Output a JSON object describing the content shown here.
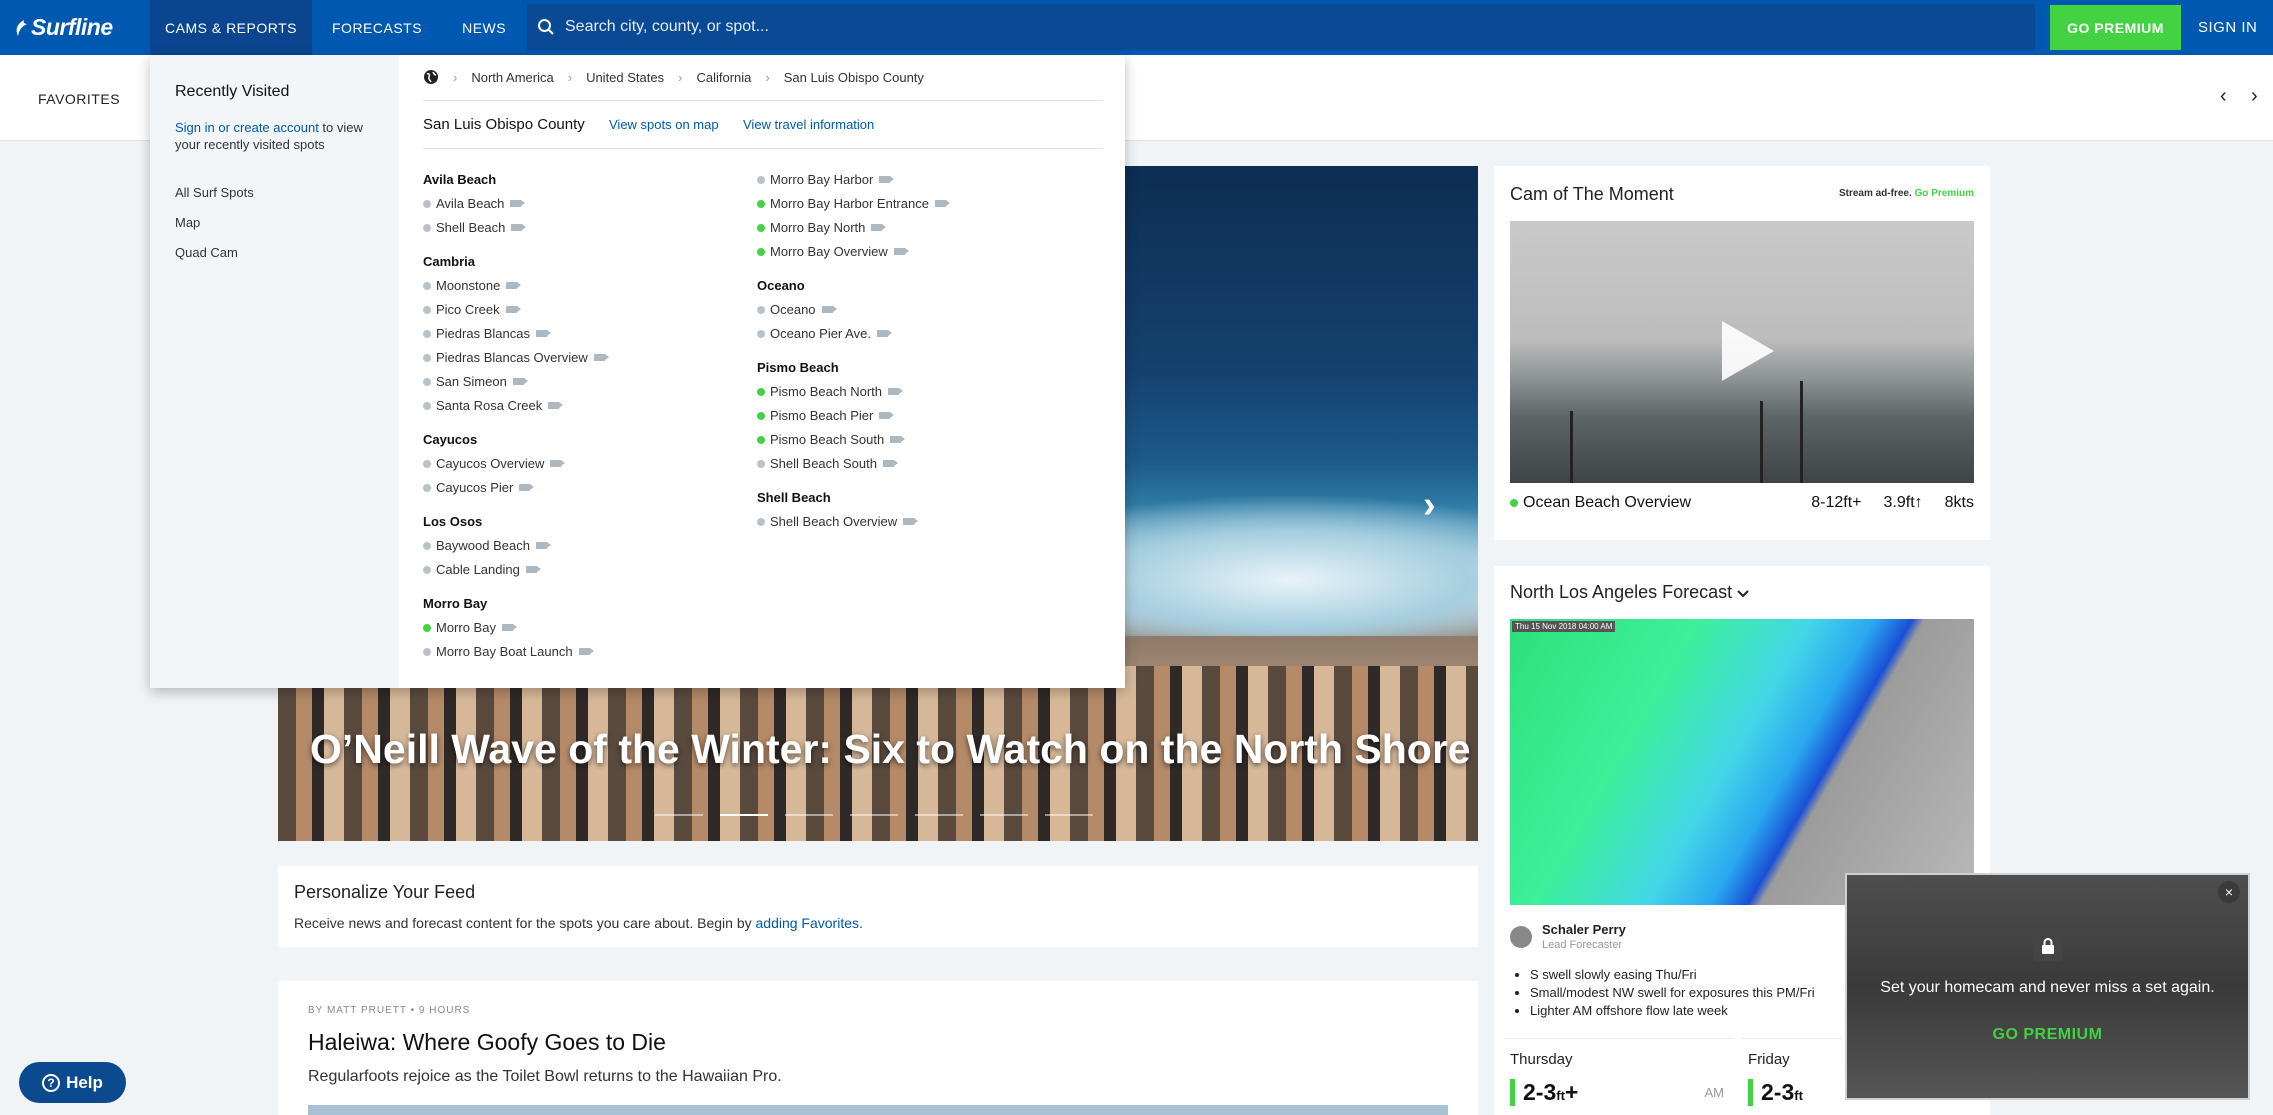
{
  "nav": {
    "logo": "Surfline",
    "tabs": [
      "CAMS & REPORTS",
      "FORECASTS",
      "NEWS"
    ],
    "search_placeholder": "Search city, county, or spot...",
    "premium": "GO PREMIUM",
    "signin": "SIGN IN"
  },
  "favbar": {
    "label": "FAVORITES",
    "prev": "‹",
    "next": "›"
  },
  "hero": {
    "title": "O’Neill Wave of the Winter: Six to Watch on the North Shore",
    "next": "›"
  },
  "feed": {
    "title": "Personalize Your Feed",
    "text": "Receive news and forecast content for the spots you care about. Begin by ",
    "link": "adding Favorites",
    "end": "."
  },
  "article": {
    "byline": "BY MATT PRUETT • 9 HOURS",
    "title": "Haleiwa: Where Goofy Goes to Die",
    "subtitle": "Regularfoots rejoice as the Toilet Bowl returns to the Hawaiian Pro."
  },
  "cotm": {
    "title": "Cam of The Moment",
    "stream_text": "Stream ad-free.",
    "stream_link": "Go Premium",
    "spot": "Ocean Beach Overview",
    "height": "8-12ft+",
    "swell": "3.9ft↑",
    "wind": "8kts"
  },
  "nla": {
    "title": "North Los Angeles Forecast",
    "map_stamp": "Thu 15 Nov 2018 04:00 AM",
    "forecaster": "Schaler Perry",
    "role": "Lead Forecaster",
    "bullets": [
      "S swell slowly easing Thu/Fri",
      "Small/modest NW swell for exposures this PM/Fri",
      "Lighter AM offshore flow late week"
    ],
    "days": [
      {
        "name": "Thursday",
        "value": "2-3",
        "unit": "ft",
        "plus": "+",
        "period": "AM"
      },
      {
        "name": "Friday",
        "value": "2-3",
        "unit": "ft",
        "plus": "",
        "period": ""
      }
    ]
  },
  "homecam": {
    "message": "Set your homecam and never miss a set again.",
    "cta": "GO PREMIUM",
    "close": "×"
  },
  "help": {
    "label": "Help",
    "icon": "?"
  },
  "dropdown": {
    "recent_title": "Recently Visited",
    "signin_link": "Sign in or create account",
    "signin_rest": " to view your recently visited spots",
    "links": [
      "All Surf Spots",
      "Map",
      "Quad Cam"
    ],
    "breadcrumb": [
      "North America",
      "United States",
      "California",
      "San Luis Obispo County"
    ],
    "county": "San Luis Obispo County",
    "view_map": "View spots on map",
    "view_travel": "View travel information",
    "left_col": [
      {
        "region": "Avila Beach",
        "spots": [
          [
            "Avila Beach",
            false
          ],
          [
            "Shell Beach",
            false
          ]
        ]
      },
      {
        "region": "Cambria",
        "spots": [
          [
            "Moonstone",
            false
          ],
          [
            "Pico Creek",
            false
          ],
          [
            "Piedras Blancas",
            false
          ],
          [
            "Piedras Blancas Overview",
            false
          ],
          [
            "San Simeon",
            false
          ],
          [
            "Santa Rosa Creek",
            false
          ]
        ]
      },
      {
        "region": "Cayucos",
        "spots": [
          [
            "Cayucos Overview",
            false
          ],
          [
            "Cayucos Pier",
            false
          ]
        ]
      },
      {
        "region": "Los Osos",
        "spots": [
          [
            "Baywood Beach",
            false
          ],
          [
            "Cable Landing",
            false
          ]
        ]
      },
      {
        "region": "Morro Bay",
        "spots": [
          [
            "Morro Bay",
            true
          ],
          [
            "Morro Bay Boat Launch",
            false
          ]
        ]
      }
    ],
    "right_col": [
      {
        "region": "",
        "spots": [
          [
            "Morro Bay Harbor",
            false
          ],
          [
            "Morro Bay Harbor Entrance",
            true
          ],
          [
            "Morro Bay North",
            true
          ],
          [
            "Morro Bay Overview",
            true
          ]
        ]
      },
      {
        "region": "Oceano",
        "spots": [
          [
            "Oceano",
            false
          ],
          [
            "Oceano Pier Ave.",
            false
          ]
        ]
      },
      {
        "region": "Pismo Beach",
        "spots": [
          [
            "Pismo Beach North",
            true
          ],
          [
            "Pismo Beach Pier",
            true
          ],
          [
            "Pismo Beach South",
            true
          ],
          [
            "Shell Beach South",
            false
          ]
        ]
      },
      {
        "region": "Shell Beach",
        "spots": [
          [
            "Shell Beach Overview",
            false
          ]
        ]
      }
    ]
  }
}
